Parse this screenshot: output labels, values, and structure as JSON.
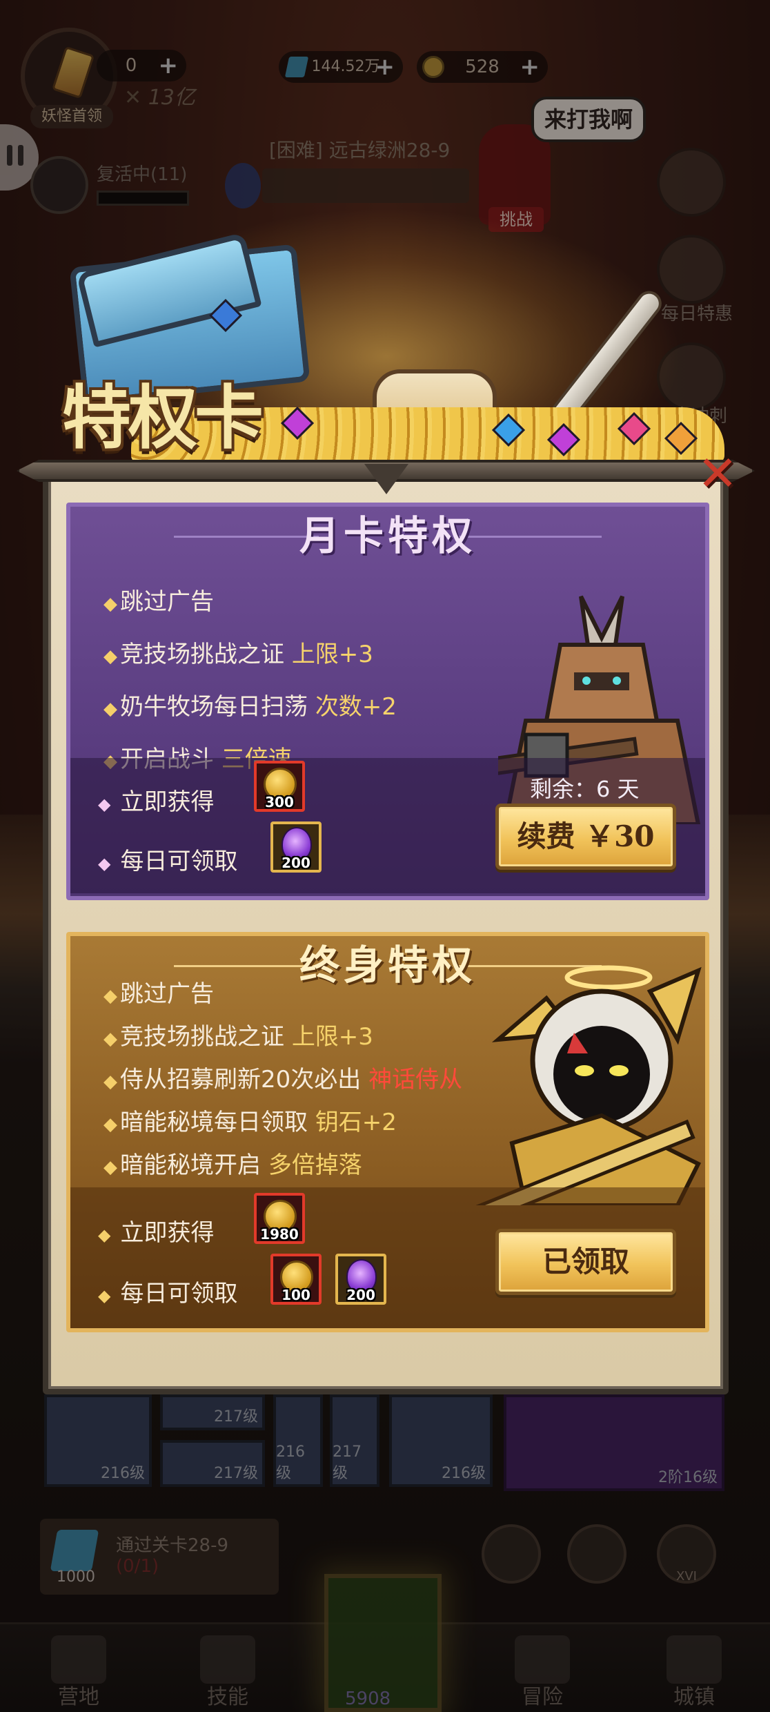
{
  "hud": {
    "player_name": "妖怪首领",
    "tickets": "0",
    "power": "13亿",
    "gems": "144.52万",
    "coins": "528"
  },
  "status": {
    "revive_label": "复活中(11)",
    "stage_name": "[困难] 远古绿洲28-9",
    "boss_bubble": "来打我啊",
    "boss_button": "挑战"
  },
  "side_menu": {
    "daily_deal": "每日特惠",
    "sprint": "文冲刺"
  },
  "privilege": {
    "banner_title": "特权卡",
    "monthly": {
      "title": "月卡特权",
      "perks": [
        {
          "text": "跳过广告",
          "highlight": ""
        },
        {
          "text": "竞技场挑战之证 ",
          "highlight": "上限+3"
        },
        {
          "text": "奶牛牧场每日扫荡 ",
          "highlight": "次数+2"
        },
        {
          "text": "开启战斗 ",
          "highlight": "三倍速"
        }
      ],
      "instant_label": "立即获得",
      "daily_label": "每日可领取",
      "instant_items": [
        {
          "icon": "skull-coin",
          "count": "300"
        }
      ],
      "daily_items": [
        {
          "icon": "purple-soul-orb",
          "count": "200"
        }
      ],
      "remaining": "剩余：6 天",
      "renew_button": "续费 ￥30"
    },
    "lifetime": {
      "title": "终身特权",
      "perks": [
        {
          "text": "跳过广告",
          "highlight": ""
        },
        {
          "text": "竞技场挑战之证 ",
          "highlight": "上限+3"
        },
        {
          "text": "侍从招募刷新20次必出 ",
          "highlight": "神话侍从",
          "red": true
        },
        {
          "text": "暗能秘境每日领取 ",
          "highlight": "钥石+2"
        },
        {
          "text": "暗能秘境开启 ",
          "highlight": "多倍掉落"
        }
      ],
      "instant_label": "立即获得",
      "daily_label": "每日可领取",
      "instant_items": [
        {
          "icon": "skull-coin",
          "count": "1980"
        }
      ],
      "daily_items": [
        {
          "icon": "skull-coin",
          "count": "100"
        },
        {
          "icon": "purple-soul-orb",
          "count": "200"
        }
      ],
      "claimed_button": "已领取"
    }
  },
  "equipment": {
    "levels": [
      "216级",
      "217级",
      "217级",
      "216级",
      "217级",
      "216级",
      "2阶16级"
    ]
  },
  "quest": {
    "title": "通过关卡28-9",
    "progress": "(0/1)",
    "reward": "1000"
  },
  "round_button_label": "XVI",
  "bottom_nav": {
    "items": [
      "营地",
      "技能",
      "冒险",
      "城镇"
    ],
    "center_count": "5908"
  },
  "colors": {
    "monthly_panel": "#6f4f95",
    "lifetime_panel": "#a97a35",
    "highlight_gold": "#f6d36b",
    "highlight_red": "#ff4a3a",
    "close_red": "#c93a2a"
  }
}
